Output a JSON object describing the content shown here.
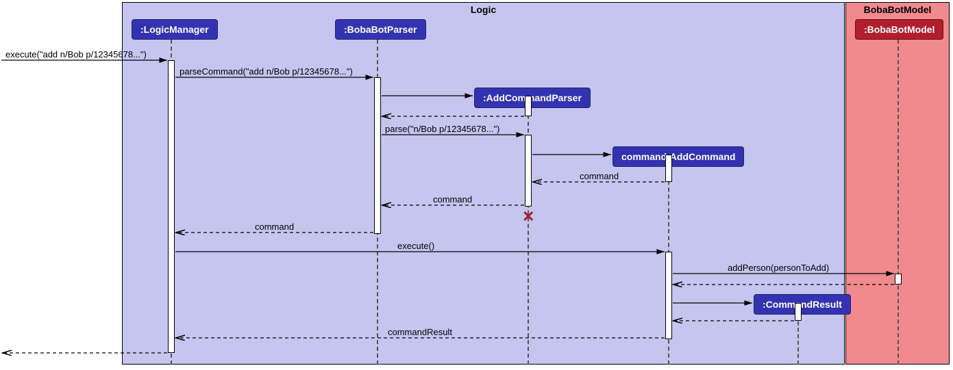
{
  "frames": {
    "logic": {
      "label": "Logic"
    },
    "model": {
      "label": "BobaBotModel"
    }
  },
  "participants": {
    "logicManager": ":LogicManager",
    "bobaBotParser": ":BobaBotParser",
    "addCommandParser": ":AddCommandParser",
    "addCommand": "command:AddCommand",
    "commandResult": ":CommandResult",
    "bobaBotModel": ":BobaBotModel"
  },
  "messages": {
    "execute_in": "execute(\"add n/Bob p/12345678...\")",
    "parseCommand": "parseCommand(\"add n/Bob p/12345678...\")",
    "parse": "parse(\"n/Bob p/12345678...\")",
    "command_return1": "command",
    "command_return2": "command",
    "command_return3": "command",
    "execute_call": "execute()",
    "addPerson": "addPerson(personToAdd)",
    "commandResult": "commandResult"
  },
  "chart_data": {
    "type": "sequence-diagram",
    "frames": [
      {
        "name": "Logic",
        "participants": [
          "LogicManager",
          "BobaBotParser",
          "AddCommandParser",
          "AddCommand",
          "CommandResult"
        ]
      },
      {
        "name": "BobaBotModel",
        "participants": [
          "BobaBotModel"
        ]
      }
    ],
    "lifelines": [
      {
        "id": "caller",
        "label": ""
      },
      {
        "id": "LogicManager",
        "label": ":LogicManager"
      },
      {
        "id": "BobaBotParser",
        "label": ":BobaBotParser"
      },
      {
        "id": "AddCommandParser",
        "label": ":AddCommandParser",
        "created_by": "BobaBotParser",
        "destroyed": true
      },
      {
        "id": "AddCommand",
        "label": "command:AddCommand",
        "created_by": "AddCommandParser"
      },
      {
        "id": "CommandResult",
        "label": ":CommandResult",
        "created_by": "AddCommand"
      },
      {
        "id": "BobaBotModel",
        "label": ":BobaBotModel"
      }
    ],
    "messages": [
      {
        "from": "caller",
        "to": "LogicManager",
        "label": "execute(\"add n/Bob p/12345678...\")",
        "type": "sync"
      },
      {
        "from": "LogicManager",
        "to": "BobaBotParser",
        "label": "parseCommand(\"add n/Bob p/12345678...\")",
        "type": "sync"
      },
      {
        "from": "BobaBotParser",
        "to": "AddCommandParser",
        "label": "",
        "type": "create"
      },
      {
        "from": "AddCommandParser",
        "to": "BobaBotParser",
        "label": "",
        "type": "return"
      },
      {
        "from": "BobaBotParser",
        "to": "AddCommandParser",
        "label": "parse(\"n/Bob p/12345678...\")",
        "type": "sync"
      },
      {
        "from": "AddCommandParser",
        "to": "AddCommand",
        "label": "",
        "type": "create"
      },
      {
        "from": "AddCommand",
        "to": "AddCommandParser",
        "label": "command",
        "type": "return"
      },
      {
        "from": "AddCommandParser",
        "to": "BobaBotParser",
        "label": "command",
        "type": "return"
      },
      {
        "from": "AddCommandParser",
        "to": "",
        "label": "",
        "type": "destroy"
      },
      {
        "from": "BobaBotParser",
        "to": "LogicManager",
        "label": "command",
        "type": "return"
      },
      {
        "from": "LogicManager",
        "to": "AddCommand",
        "label": "execute()",
        "type": "sync"
      },
      {
        "from": "AddCommand",
        "to": "BobaBotModel",
        "label": "addPerson(personToAdd)",
        "type": "sync"
      },
      {
        "from": "BobaBotModel",
        "to": "AddCommand",
        "label": "",
        "type": "return"
      },
      {
        "from": "AddCommand",
        "to": "CommandResult",
        "label": "",
        "type": "create"
      },
      {
        "from": "CommandResult",
        "to": "AddCommand",
        "label": "",
        "type": "return"
      },
      {
        "from": "AddCommand",
        "to": "LogicManager",
        "label": "commandResult",
        "type": "return"
      },
      {
        "from": "LogicManager",
        "to": "caller",
        "label": "",
        "type": "return"
      }
    ]
  }
}
